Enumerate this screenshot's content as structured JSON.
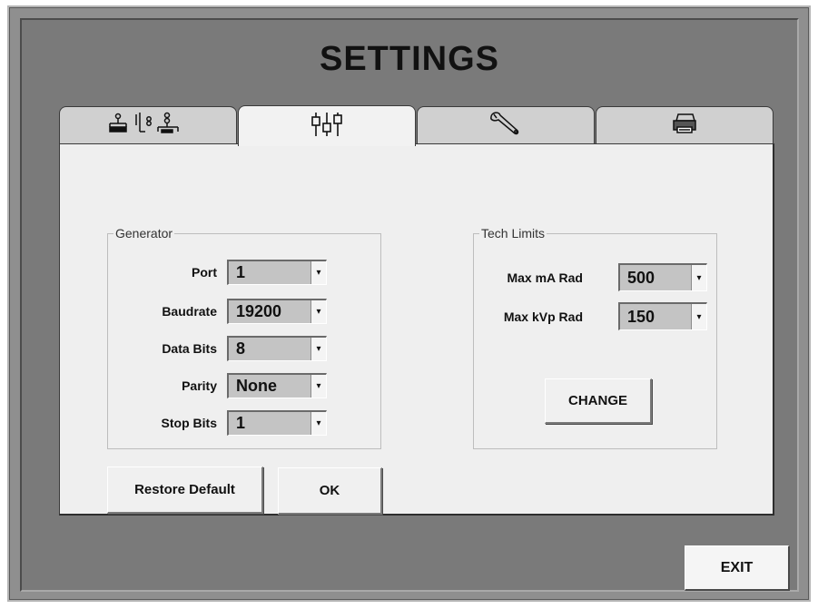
{
  "title": "SETTINGS",
  "tabs": [
    {
      "icon": "network-icon",
      "active": false
    },
    {
      "icon": "sliders-icon",
      "active": true
    },
    {
      "icon": "wrench-icon",
      "active": false
    },
    {
      "icon": "printer-icon",
      "active": false
    }
  ],
  "generator": {
    "legend": "Generator",
    "port_label": "Port",
    "port_value": "1",
    "baudrate_label": "Baudrate",
    "baudrate_value": "19200",
    "databits_label": "Data Bits",
    "databits_value": "8",
    "parity_label": "Parity",
    "parity_value": "None",
    "stopbits_label": "Stop Bits",
    "stopbits_value": "1"
  },
  "tech_limits": {
    "legend": "Tech Limits",
    "max_ma_label": "Max mA Rad",
    "max_ma_value": "500",
    "max_kvp_label": "Max kVp Rad",
    "max_kvp_value": "150",
    "change_label": "CHANGE"
  },
  "buttons": {
    "restore_label": "Restore Default",
    "ok_label": "OK",
    "exit_label": "EXIT"
  },
  "colors": {
    "frame": "#8f8f8f",
    "background": "#7a7a7a",
    "panel": "#efefef",
    "combo": "#c4c4c4"
  }
}
